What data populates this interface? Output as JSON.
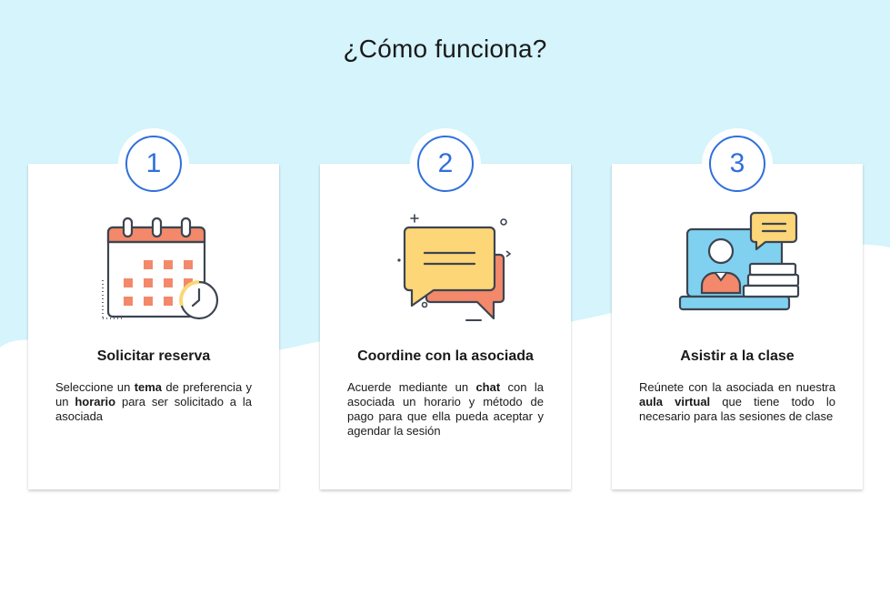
{
  "page": {
    "title": "¿Cómo funciona?"
  },
  "colors": {
    "background_band": "#d5f4fc",
    "badge_accent": "#2f6fdc",
    "illustration_orange": "#f3896a",
    "illustration_yellow": "#fcd677",
    "illustration_blue": "#7fd1ef",
    "card_background": "#ffffff"
  },
  "steps": [
    {
      "number": "1",
      "icon": "calendar-clock-icon",
      "title": "Solicitar reserva",
      "desc": {
        "t1": "Seleccione un ",
        "b1": "tema",
        "t2": " de preferencia y un ",
        "b2": "horario",
        "t3": " para ser solicitado a la asociada"
      }
    },
    {
      "number": "2",
      "icon": "chat-bubbles-icon",
      "title": "Coordine con la asociada",
      "desc": {
        "t1": "Acuerde mediante un ",
        "b1": "chat",
        "t2": " con la asociada un horario y método de pago para que ella pueda aceptar y agendar la sesión"
      }
    },
    {
      "number": "3",
      "icon": "virtual-classroom-icon",
      "title": "Asistir a la clase",
      "desc": {
        "t1": "Reúnete con la asociada en nuestra ",
        "b1": "aula virtual",
        "t2": " que tiene todo lo necesario para las sesiones de clase"
      }
    }
  ]
}
